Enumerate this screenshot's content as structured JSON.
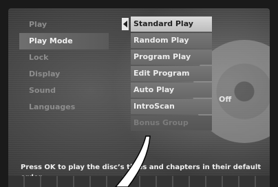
{
  "left_menu": {
    "items": [
      {
        "label": "Play"
      },
      {
        "label": "Play Mode"
      },
      {
        "label": "Lock"
      },
      {
        "label": "Display"
      },
      {
        "label": "Sound"
      },
      {
        "label": "Languages"
      }
    ]
  },
  "sub_menu": {
    "items": [
      {
        "label": "Standard Play"
      },
      {
        "label": "Random Play"
      },
      {
        "label": "Program Play"
      },
      {
        "label": "Edit Program"
      },
      {
        "label": "Auto Play"
      },
      {
        "label": "IntroScan"
      },
      {
        "label": "Bonus Group"
      }
    ],
    "auto_play_value": "Off"
  },
  "help_text": "Press OK to play the disc’s titles and chapters in their default order."
}
